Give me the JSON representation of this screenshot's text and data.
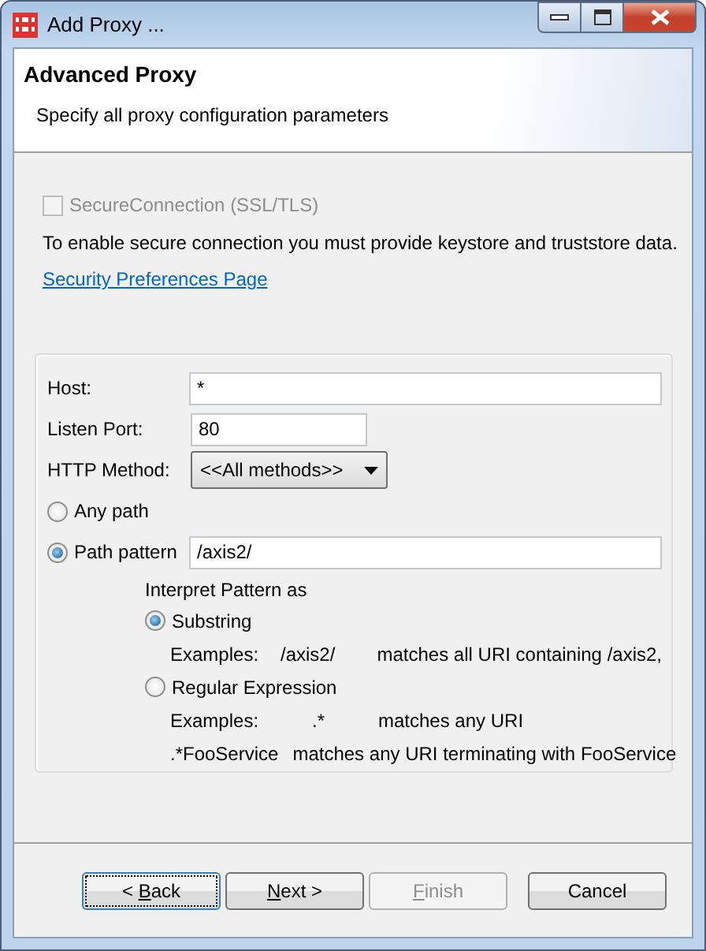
{
  "window": {
    "title": "Add Proxy ..."
  },
  "header": {
    "title": "Advanced Proxy",
    "subtitle": "Specify all proxy configuration parameters"
  },
  "secure_connection": {
    "label": "SecureConnection (SSL/TLS)",
    "checked": false,
    "disabled": true
  },
  "info_text": "To enable secure connection you must provide keystore and truststore data.",
  "link": "Security Preferences Page",
  "fields": [
    {
      "kind": "text",
      "label": "Host:",
      "value": "*"
    },
    {
      "kind": "number",
      "label": "Listen Port:",
      "value": "80"
    },
    {
      "kind": "dropdown",
      "label": "HTTP Method:",
      "value": "<<All methods>>"
    }
  ],
  "path_options": [
    {
      "label": "Any path",
      "selected": false
    },
    {
      "label": "Path pattern",
      "selected": true,
      "value": "/axis2/"
    }
  ],
  "interpret": {
    "title": "Interpret Pattern as",
    "options": [
      {
        "label": "Substring",
        "selected": true,
        "examples": [
          {
            "label": "Examples:",
            "pattern": "/axis2/",
            "meaning": "matches all URI containing /axis2,"
          }
        ]
      },
      {
        "label": "Regular Expression",
        "selected": false,
        "examples": [
          {
            "label": "Examples:",
            "pattern": ".*",
            "meaning": "matches any URI"
          },
          {
            "pattern": ".*FooService",
            "meaning": "matches any URI terminating with FooService"
          }
        ]
      }
    ]
  },
  "buttons": [
    {
      "label": {
        "before": "< ",
        "key": "B",
        "after": "ack"
      },
      "disabled": false,
      "focused": true
    },
    {
      "label": {
        "key": "N",
        "after": "ext >"
      },
      "disabled": false,
      "focused": false
    },
    {
      "label": {
        "key": "F",
        "after": "inish"
      },
      "disabled": true,
      "focused": false
    },
    {
      "label": {
        "after": "Cancel"
      },
      "disabled": false,
      "focused": false
    }
  ]
}
